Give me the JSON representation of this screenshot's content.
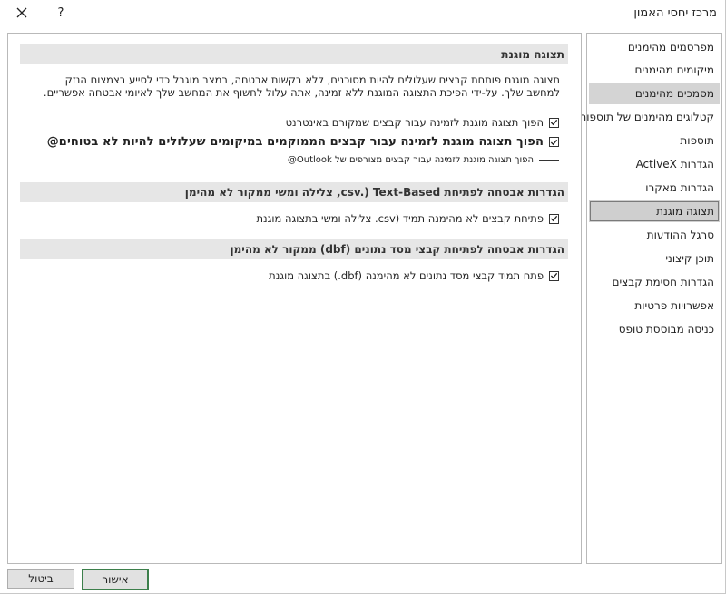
{
  "window": {
    "title": "מרכז יחסי האמון",
    "help_label": "?"
  },
  "nav": {
    "items": [
      {
        "label": "מפרסמים מהימנים"
      },
      {
        "label": "מיקומים מהימנים"
      },
      {
        "label": "מסמכים מהימנים"
      },
      {
        "label": "קטלוגים מהימנים של תוספות"
      },
      {
        "label": "תוספות"
      },
      {
        "label": "הגדרות ActiveX"
      },
      {
        "label": "הגדרות מאקרו"
      },
      {
        "label": "תצוגה מוגנת"
      },
      {
        "label": "סרגל ההודעות"
      },
      {
        "label": "תוכן קיצוני"
      },
      {
        "label": "הגדרות חסימת קבצים"
      },
      {
        "label": "אפשרויות פרטיות"
      },
      {
        "label": "כניסה מבוססת טופס"
      }
    ],
    "selected_index": 7
  },
  "protected_view": {
    "header": "תצוגה מוגנת",
    "description": "תצוגה מוגנת פותחת קבצים שעלולים להיות מסוכנים, ללא בקשות אבטחה, במצב מוגבל כדי לסייע בצמצום הנזק למחשב שלך. על-ידי הפיכת התצוגה המוגנת ללא זמינה, אתה עלול לחשוף את המחשב שלך לאיומי אבטחה אפשריים.",
    "options": [
      {
        "label": "הפוך תצוגה מוגנת לזמינה עבור קבצים שמקורם באינטרנט",
        "checked": true
      },
      {
        "label": "הפוך תצוגה מוגנת לזמינה עבור קבצים הממוקמים במיקומים שעלולים להיות לא בטוחים@",
        "checked": true
      },
      {
        "label": "הפוך תצוגה מוגנת לזמינה עבור קבצים מצורפים של Outlook@",
        "checked": false
      }
    ]
  },
  "csv_section": {
    "header": "הגדרות אבטחה לפתיחת csv.) Text-Based, צלילה ומשי ממקור לא מהימן",
    "option": {
      "label": "פתיחת קבצים לא מהימנה תמיד (csv.  צלילה ומשי בתצוגה מוגנת",
      "checked": true
    }
  },
  "dbf_section": {
    "header": "הגדרות אבטחה לפתיחת קבצי מסד נתונים (dbf) ממקור לא מהימן",
    "option": {
      "label": "פתח תמיד קבצי מסד נתונים לא מהימנה (dbf.) בתצוגה מוגנת",
      "checked": true
    }
  },
  "footer": {
    "ok_label": "אישור",
    "cancel_label": "ביטול"
  }
}
